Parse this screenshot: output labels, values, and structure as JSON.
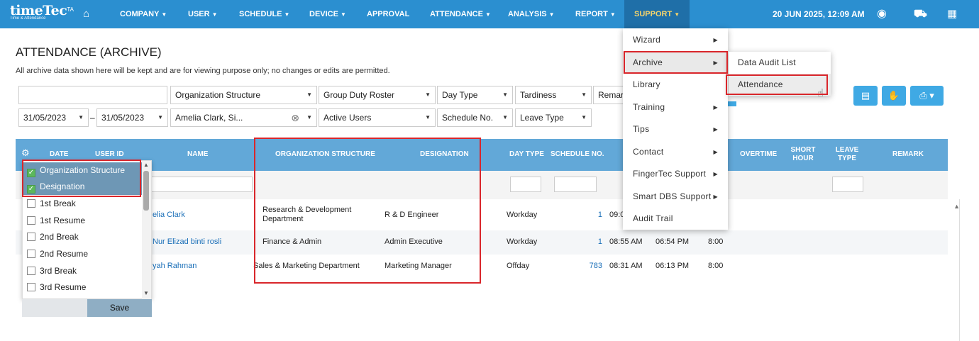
{
  "brand": {
    "name": "timeTec",
    "badge": "TA",
    "tagline": "Time & Attendance"
  },
  "nav": {
    "items": [
      "COMPANY",
      "USER",
      "SCHEDULE",
      "DEVICE",
      "APPROVAL",
      "ATTENDANCE",
      "ANALYSIS",
      "REPORT",
      "SUPPORT"
    ],
    "caret": "▼",
    "datetime": "20 JUN 2025, 12:09 AM"
  },
  "page": {
    "title": "ATTENDANCE (ARCHIVE)",
    "note": "All archive data shown here will be kept and are for viewing purpose only; no changes or edits are permitted."
  },
  "filters": {
    "org": "Organization Structure",
    "roster": "Group Duty Roster",
    "daytype": "Day Type",
    "tardiness": "Tardiness",
    "remark": "Remar",
    "date_from": "31/05/2023",
    "date_sep": "–",
    "date_to": "31/05/2023",
    "users": "Amelia Clark, Si...",
    "active": "Active Users",
    "schedule": "Schedule No.",
    "leave": "Leave Type"
  },
  "table": {
    "headers": {
      "date": "DATE",
      "user_id": "USER ID",
      "name": "NAME",
      "org": "ORGANIZATION STRUCTURE",
      "designation": "DESIGNATION",
      "day_type": "DAY TYPE",
      "schedule": "SCHEDULE NO.",
      "overtime": "OVERTIME",
      "short_hour_1": "SHORT",
      "short_hour_2": "HOUR",
      "leave_type_1": "LEAVE",
      "leave_type_2": "TYPE",
      "remark": "REMARK"
    },
    "rows": [
      {
        "name": "elia Clark",
        "org": "Research & Development Department",
        "designation": "R & D Engineer",
        "day_type": "Workday",
        "schedule": "1",
        "in": "09:0",
        "out": "",
        "hours": ""
      },
      {
        "name": "Nur Elizad binti rosli",
        "org": "Finance & Admin",
        "designation": "Admin Executive",
        "day_type": "Workday",
        "schedule": "1",
        "in": "08:55 AM",
        "out": "06:54 PM",
        "hours": "8:00"
      },
      {
        "name": "yah Rahman",
        "org": "Sales & Marketing Department",
        "designation": "Marketing Manager",
        "day_type": "Offday",
        "schedule": "783",
        "in": "08:31 AM",
        "out": "06:13 PM",
        "hours": "8:00"
      }
    ]
  },
  "column_chooser": {
    "options": [
      {
        "label": "Organization Structure",
        "checked": true
      },
      {
        "label": "Designation",
        "checked": true
      },
      {
        "label": "1st Break",
        "checked": false
      },
      {
        "label": "1st Resume",
        "checked": false
      },
      {
        "label": "2nd Break",
        "checked": false
      },
      {
        "label": "2nd Resume",
        "checked": false
      },
      {
        "label": "3rd Break",
        "checked": false
      },
      {
        "label": "3rd Resume",
        "checked": false
      }
    ],
    "save_label": "Save"
  },
  "support_menu": {
    "items": [
      {
        "label": "Wizard",
        "arrow": "▶"
      },
      {
        "label": "Archive",
        "arrow": "▶"
      },
      {
        "label": "Library",
        "arrow": ""
      },
      {
        "label": "Training",
        "arrow": "▶"
      },
      {
        "label": "Tips",
        "arrow": "▶"
      },
      {
        "label": "Contact",
        "arrow": "▶"
      },
      {
        "label": "FingerTec Support",
        "arrow": "▶"
      },
      {
        "label": "Smart DBS Support",
        "arrow": "▶"
      },
      {
        "label": "Audit Trail",
        "arrow": ""
      }
    ]
  },
  "archive_submenu": {
    "items": [
      "Data Audit List",
      "Attendance"
    ]
  },
  "colors": {
    "nav": "#2b8fd0",
    "nav_active": "#1f6fa8",
    "header": "#62a8d8",
    "highlight": "#d9262b"
  }
}
